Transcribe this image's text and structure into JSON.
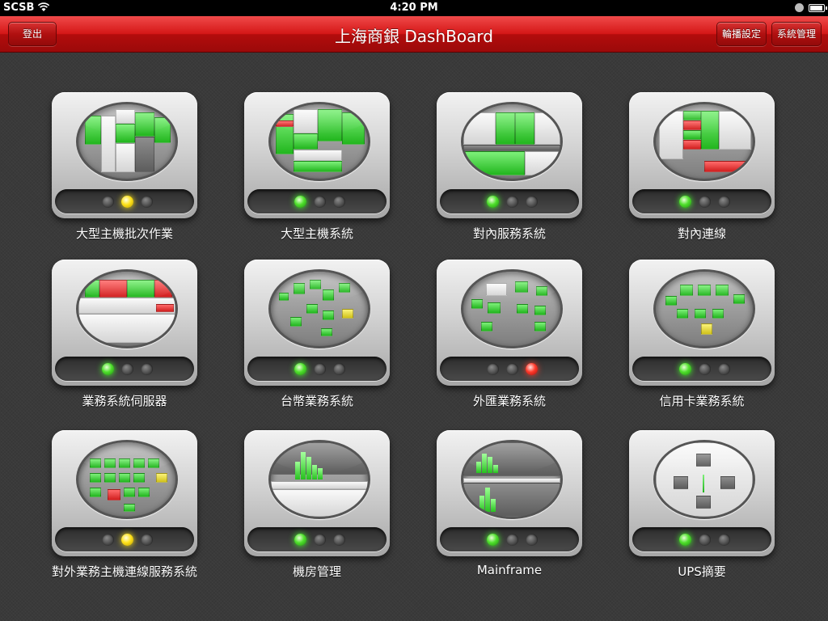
{
  "status_bar": {
    "carrier": "SCSB",
    "time": "4:20 PM",
    "wifi_icon": "wifi-icon",
    "lock_icon": "orientation-lock-icon",
    "battery_icon": "battery-icon"
  },
  "nav": {
    "title": "上海商銀 DashBoard",
    "logout_label": "登出",
    "carousel_settings_label": "輪播設定",
    "system_admin_label": "系統管理"
  },
  "colors": {
    "nav_red": "#d41616",
    "led_green": "#4fe02c",
    "led_yellow": "#ffe21a",
    "led_red": "#ff3a2a",
    "background": "#3a3a3a"
  },
  "tiles": [
    {
      "label": "大型主機批次作業",
      "status": "yellow"
    },
    {
      "label": "大型主機系統",
      "status": "green"
    },
    {
      "label": "對內服務系統",
      "status": "green"
    },
    {
      "label": "對內連線",
      "status": "green"
    },
    {
      "label": "業務系統伺服器",
      "status": "green"
    },
    {
      "label": "台幣業務系統",
      "status": "green"
    },
    {
      "label": "外匯業務系統",
      "status": "red"
    },
    {
      "label": "信用卡業務系統",
      "status": "green"
    },
    {
      "label": "對外業務主機連線服務系統",
      "status": "yellow"
    },
    {
      "label": "機房管理",
      "status": "green"
    },
    {
      "label": "Mainframe",
      "status": "green"
    },
    {
      "label": "UPS摘要",
      "status": "green"
    }
  ]
}
